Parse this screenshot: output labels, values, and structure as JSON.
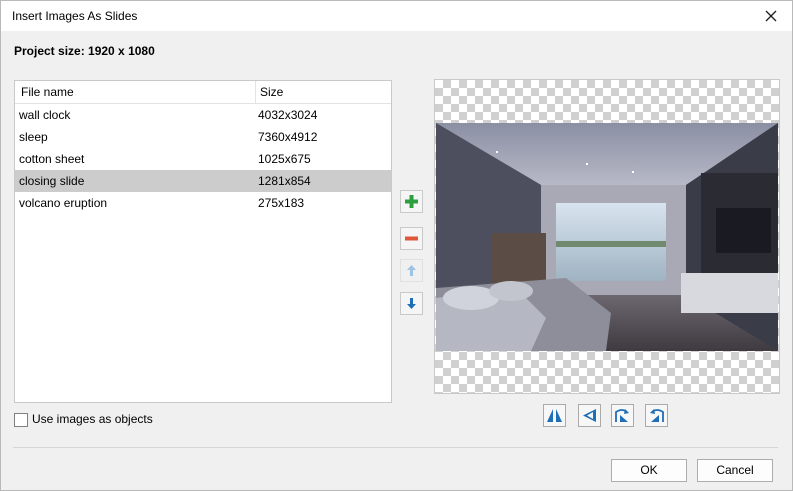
{
  "window": {
    "title": "Insert Images As Slides"
  },
  "project": {
    "size_text": "Project size: 1920 x 1080"
  },
  "table": {
    "columns": [
      "File name",
      "Size"
    ],
    "rows": [
      {
        "name": "wall clock",
        "size": "4032x3024"
      },
      {
        "name": "sleep",
        "size": "7360x4912"
      },
      {
        "name": "cotton sheet",
        "size": "1025x675"
      },
      {
        "name": "closing slide",
        "size": "1281x854",
        "selected": true
      },
      {
        "name": "volcano eruption",
        "size": "275x183"
      }
    ]
  },
  "side_buttons": [
    "plus-icon",
    "minus-icon",
    "arrow-up-icon",
    "arrow-down-icon"
  ],
  "transform_buttons": [
    "flip-horizontal-icon",
    "flip-vertical-icon",
    "rotate-right-icon",
    "rotate-left-icon"
  ],
  "checkbox": {
    "label": "Use images as objects",
    "checked": false
  },
  "buttons": {
    "ok": "OK",
    "cancel": "Cancel"
  },
  "colors": {
    "accent_blue": "#1e6fb8",
    "plus_green": "#2e9e3e",
    "minus_red": "#e2573b",
    "selected_row": "#cccccc"
  }
}
